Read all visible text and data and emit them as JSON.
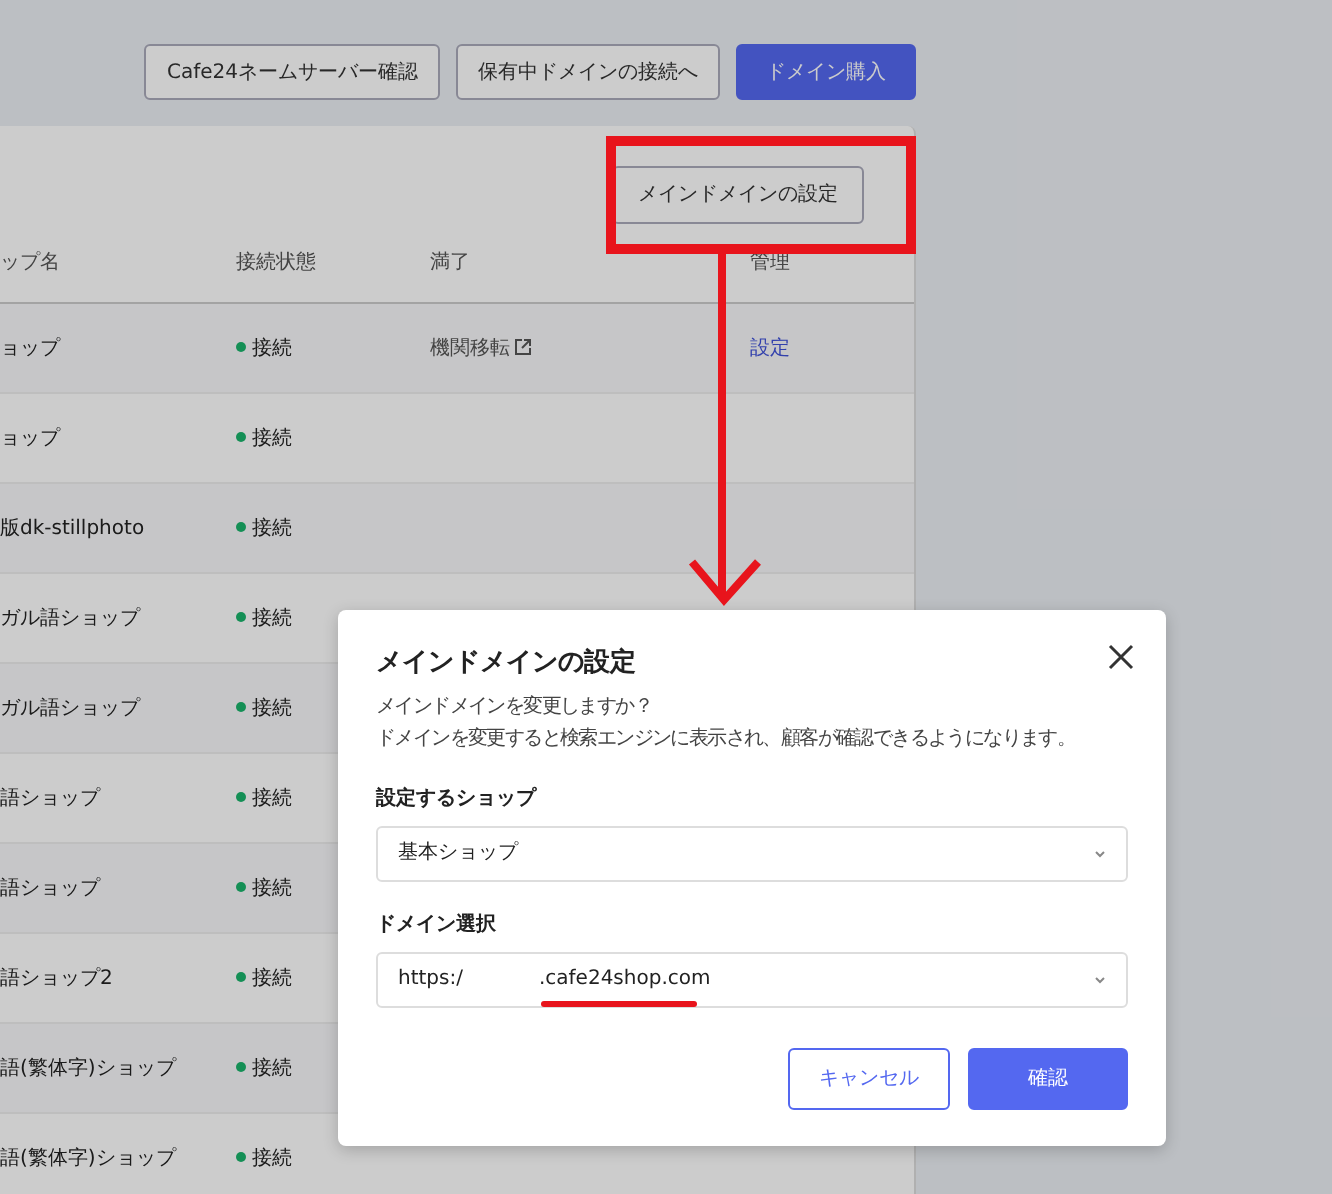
{
  "top_buttons": [
    {
      "label": "Cafe24ネームサーバー確認",
      "kind": "outline"
    },
    {
      "label": "保有中ドメインの接続へ",
      "kind": "outline"
    },
    {
      "label": "ドメイン購入",
      "kind": "primary"
    }
  ],
  "card": {
    "action_button": "メインドメインの設定",
    "table": {
      "columns": [
        "ップ名",
        "接続状態",
        "満了",
        "管理"
      ],
      "rows": [
        {
          "shop": "ョップ",
          "status": "接続",
          "connected": true,
          "expiry": "機関移転",
          "manage": "設定"
        },
        {
          "shop": "ョップ",
          "status": "接続",
          "connected": true
        },
        {
          "shop": "版dk-stillphoto",
          "status": "接続",
          "connected": true
        },
        {
          "shop": "ガル語ショップ",
          "status": "接続",
          "connected": true
        },
        {
          "shop": "ガル語ショップ",
          "status": "接続",
          "connected": true
        },
        {
          "shop": "語ショップ",
          "status": "接続",
          "connected": true
        },
        {
          "shop": "語ショップ",
          "status": "接続",
          "connected": true
        },
        {
          "shop": "語ショップ2",
          "status": "接続",
          "connected": true
        },
        {
          "shop": "語(繁体字)ショップ",
          "status": "接続",
          "connected": true
        },
        {
          "shop": "語(繁体字)ショップ",
          "status": "接続",
          "connected": true
        }
      ]
    }
  },
  "modal": {
    "title": "メインドメインの設定",
    "lines": [
      "メインドメインを変更しますか？",
      "ドメインを変更すると検索エンジンに表示され、顧客が確認できるようになります。"
    ],
    "fields": [
      {
        "label": "設定するショップ",
        "value": "基本ショップ"
      },
      {
        "label": "ドメイン選択",
        "value_prefix": "https:/",
        "value_suffix": ".cafe24shop.com"
      }
    ],
    "buttons": [
      {
        "label": "キャンセル",
        "kind": "outline"
      },
      {
        "label": "確認",
        "kind": "primary"
      }
    ]
  }
}
